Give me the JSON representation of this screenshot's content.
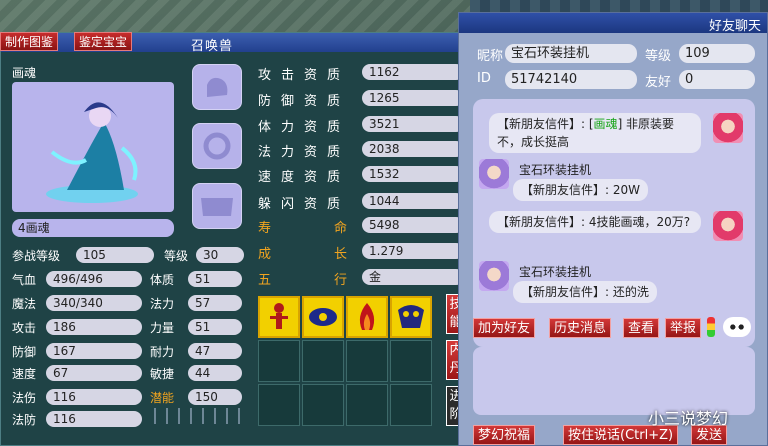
{
  "summon_window": {
    "title": "召唤兽",
    "close_glyph": "×",
    "top_tabs": [
      "制作图鉴",
      "鉴定宝宝"
    ],
    "pet_type": "画魂",
    "pet_name": "4画魂",
    "join_level_label": "参战等级",
    "join_level": "105",
    "level_label": "等级",
    "level": "30",
    "stats_left": [
      {
        "label": "气血",
        "value": "496/496"
      },
      {
        "label": "魔法",
        "value": "340/340"
      },
      {
        "label": "攻击",
        "value": "186"
      },
      {
        "label": "防御",
        "value": "167"
      },
      {
        "label": "速度",
        "value": "67"
      },
      {
        "label": "法伤",
        "value": "116"
      },
      {
        "label": "法防",
        "value": "116"
      }
    ],
    "stats_right": [
      {
        "label": "体质",
        "value": "51"
      },
      {
        "label": "法力",
        "value": "57"
      },
      {
        "label": "力量",
        "value": "51"
      },
      {
        "label": "耐力",
        "value": "47"
      },
      {
        "label": "敏捷",
        "value": "44"
      },
      {
        "label": "潜能",
        "value": "150"
      }
    ],
    "aptitudes": [
      {
        "label": "攻击资质",
        "value": "1162"
      },
      {
        "label": "防御资质",
        "value": "1265"
      },
      {
        "label": "体力资质",
        "value": "3521"
      },
      {
        "label": "法力资质",
        "value": "2038"
      },
      {
        "label": "速度资质",
        "value": "1532"
      },
      {
        "label": "躲闪资质",
        "value": "1044"
      }
    ],
    "life_label_1": "寿",
    "life_label_2": "命",
    "life": "5498",
    "growth_label_1": "成",
    "growth_label_2": "长",
    "growth": "1.279",
    "element_label_1": "五",
    "element_label_2": "行",
    "element": "金",
    "side_buttons": [
      "技能",
      "内丹",
      "进阶"
    ],
    "skill_count": 4
  },
  "chat_window": {
    "title": "好友聊天",
    "nickname_label": "昵称",
    "nickname": "宝石环装挂机",
    "level_label": "等级",
    "level": "109",
    "id_label": "ID",
    "id": "51742140",
    "friendship_label": "友好",
    "friendship": "0",
    "messages": [
      {
        "prefix": "【新朋友信件】: [",
        "highlight": "画魂",
        "suffix": "] 非原装要不，成长挺高"
      },
      {
        "sender": "宝石环装挂机",
        "text": "【新朋友信件】: 20W"
      },
      {
        "text": "【新朋友信件】: 4技能画魂，20万?"
      },
      {
        "sender": "宝石环装挂机",
        "text": "【新朋友信件】: 还的洗"
      }
    ],
    "buttons": [
      "加为好友",
      "历史消息",
      "查看",
      "举报"
    ],
    "bottom_buttons": [
      "梦幻祝福",
      "按住说话(Ctrl+Z)",
      "发送"
    ]
  },
  "watermark": "小三说梦幻"
}
